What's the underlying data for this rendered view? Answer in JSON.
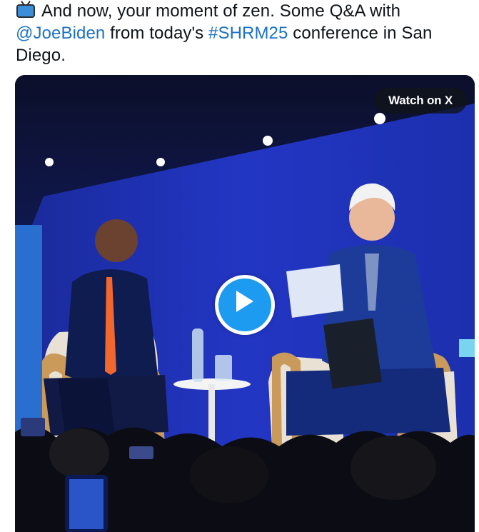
{
  "tweet": {
    "icon": "television-icon",
    "text_part1": "And now, your moment of zen. Some Q&A with ",
    "mention": "@JoeBiden",
    "text_part2": " from today's ",
    "hashtag": "#SHRM25",
    "text_part3": " conference in San Diego."
  },
  "media": {
    "watch_label": "Watch on X",
    "play_icon": "play-icon"
  },
  "colors": {
    "link": "#1d72c2",
    "play_button": "#1d9bf0",
    "stage_screen": "#1a2fb8"
  }
}
